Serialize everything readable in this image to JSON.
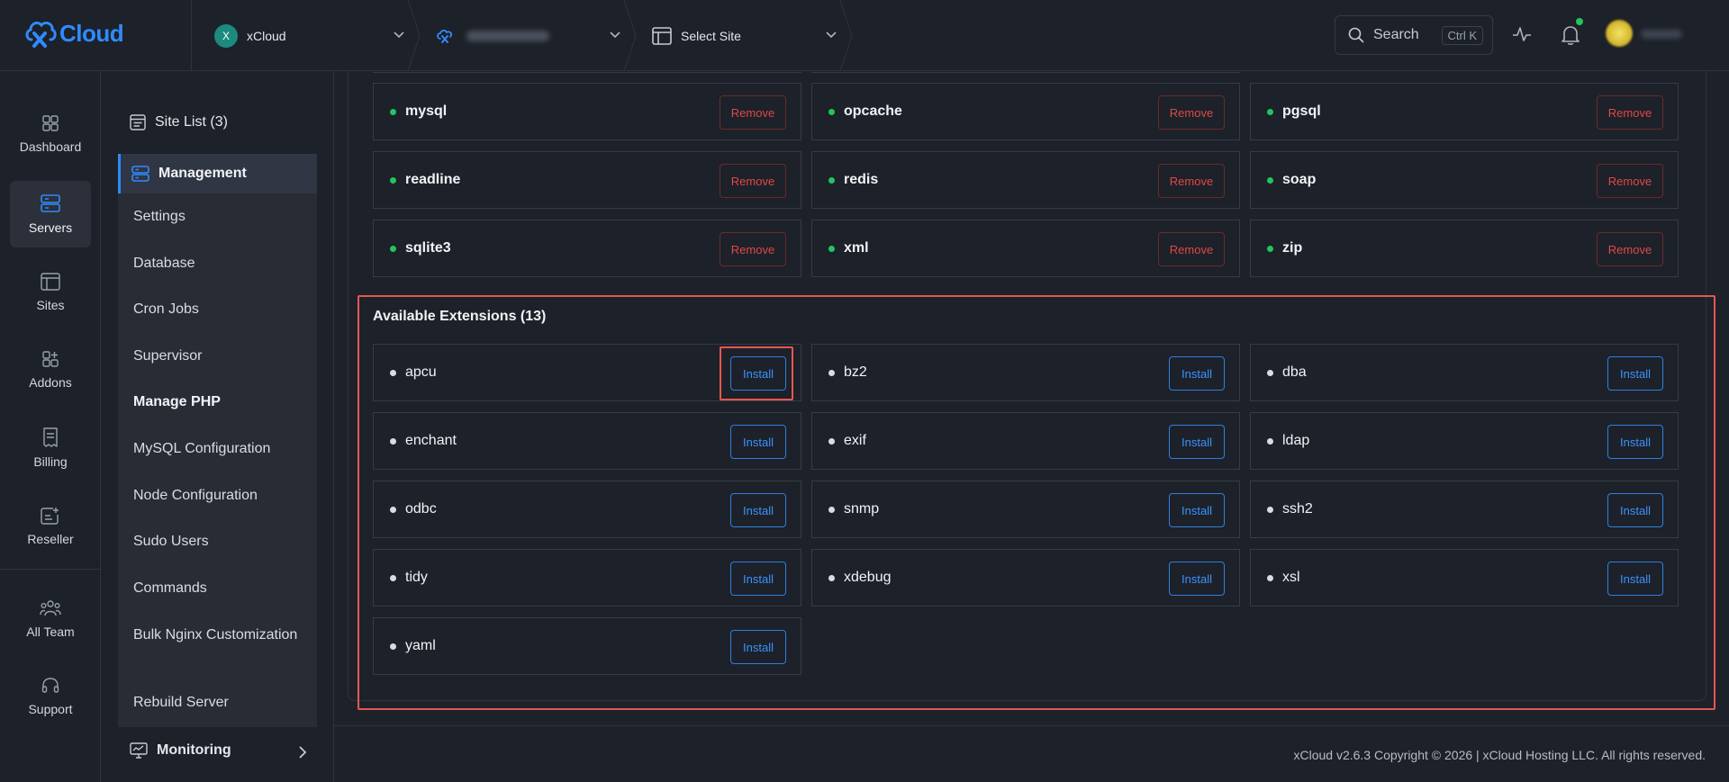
{
  "header": {
    "logo_text": "Cloud",
    "team": {
      "initial": "X",
      "name": "xCloud"
    },
    "server": {
      "name": ""
    },
    "site": {
      "label": "Select Site"
    },
    "search": {
      "label": "Search",
      "shortcut": "Ctrl K"
    },
    "user": {
      "name": ""
    }
  },
  "rail": {
    "items": [
      {
        "label": "Dashboard",
        "icon": "grid-icon"
      },
      {
        "label": "Servers",
        "icon": "server-icon"
      },
      {
        "label": "Sites",
        "icon": "layout-icon"
      },
      {
        "label": "Addons",
        "icon": "addons-icon"
      },
      {
        "label": "Billing",
        "icon": "receipt-icon"
      },
      {
        "label": "Reseller",
        "icon": "reseller-icon"
      },
      {
        "label": "All Team",
        "icon": "team-icon"
      },
      {
        "label": "Support",
        "icon": "headset-icon"
      }
    ]
  },
  "subnav": {
    "site_list": "Site List (3)",
    "section": "Management",
    "items": [
      "Settings",
      "Database",
      "Cron Jobs",
      "Supervisor",
      "Manage PHP",
      "MySQL Configuration",
      "Node Configuration",
      "Sudo Users",
      "Commands",
      "Bulk Nginx Customization",
      "Rebuild Server"
    ],
    "monitoring": "Monitoring"
  },
  "installed": {
    "remove_label": "Remove",
    "items": [
      "mysql",
      "opcache",
      "pgsql",
      "readline",
      "redis",
      "soap",
      "sqlite3",
      "xml",
      "zip"
    ]
  },
  "available": {
    "title": "Available Extensions (13)",
    "install_label": "Install",
    "items": [
      "apcu",
      "bz2",
      "dba",
      "enchant",
      "exif",
      "ldap",
      "odbc",
      "snmp",
      "ssh2",
      "tidy",
      "xdebug",
      "xsl",
      "yaml"
    ]
  },
  "footer": {
    "text": "xCloud v2.6.3 Copyright © 2026 | xCloud Hosting LLC. All rights reserved."
  },
  "colors": {
    "accent": "#2f8bff",
    "danger": "#e04848",
    "success": "#22c55e",
    "highlight": "#e5574f"
  }
}
